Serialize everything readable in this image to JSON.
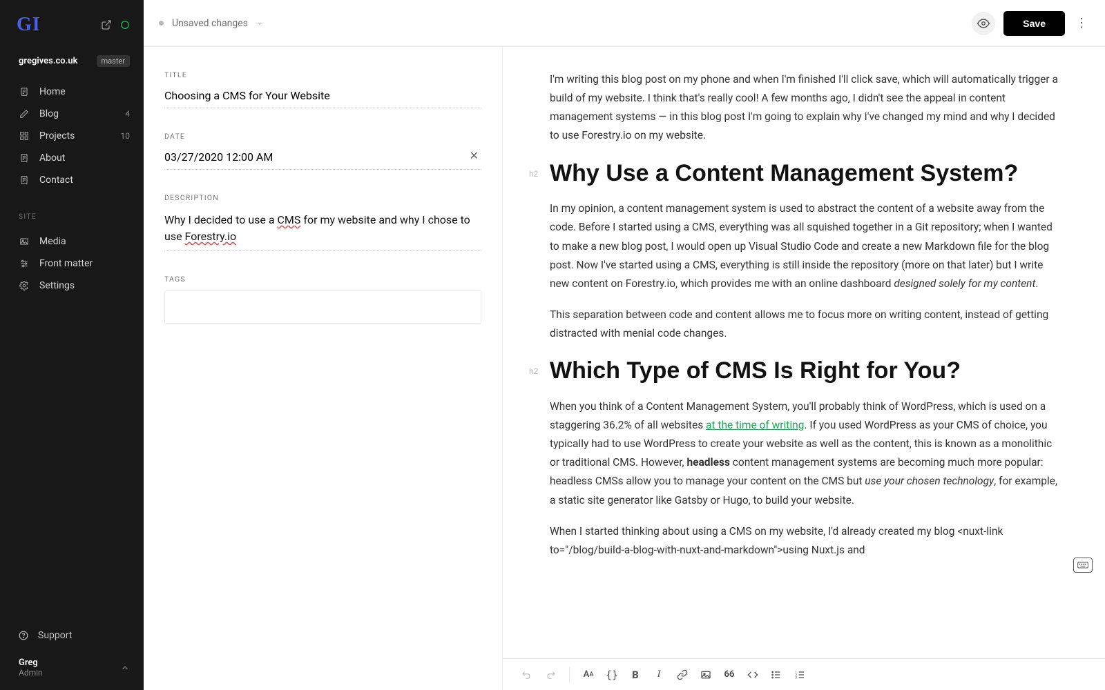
{
  "logo": "GI",
  "site_name": "gregives.co.uk",
  "branch": "master",
  "nav": {
    "items": [
      {
        "label": "Home"
      },
      {
        "label": "Blog",
        "count": "4"
      },
      {
        "label": "Projects",
        "count": "10"
      },
      {
        "label": "About"
      },
      {
        "label": "Contact"
      }
    ],
    "section_label": "SITE",
    "site_items": [
      {
        "label": "Media"
      },
      {
        "label": "Front matter"
      },
      {
        "label": "Settings"
      }
    ]
  },
  "footer": {
    "support": "Support",
    "username": "Greg",
    "role": "Admin"
  },
  "topbar": {
    "status": "Unsaved changes",
    "save": "Save"
  },
  "form": {
    "title_label": "TITLE",
    "title_value": "Choosing a CMS for Your Website",
    "date_label": "DATE",
    "date_value": "03/27/2020 12:00 AM",
    "desc_label": "DESCRIPTION",
    "desc_p1a": "Why I decided to use a ",
    "desc_sp1": "CMS",
    "desc_p1b": " for my website and why I chose to use ",
    "desc_sp2": "Forestry.io",
    "tags_label": "TAGS"
  },
  "article": {
    "intro": "I'm writing this blog post on my phone and when I'm finished I'll click save, which will automatically trigger a build of my website. I think that's really cool! A few months ago, I didn't see the appeal in content management systems — in this blog post I'm going to explain why I've changed my mind and why I decided to use Forestry.io on my website.",
    "h2_1_tag": "h2",
    "h2_1": "Why Use a Content Management System?",
    "p2a": "In my opinion, a content management system is used to abstract the content of a website away from the code. Before I started using a CMS, everything was all squished together in a Git repository; when I wanted to make a new blog post, I would open up Visual Studio Code and create a new Markdown file for the blog post. Now I've started using a CMS, everything is still inside the repository (more on that later) but I write new content on Forestry.io, which provides me with an online dashboard ",
    "p2em": "designed solely for my content",
    "p2b": ".",
    "p3": "This separation between code and content allows me to focus more on writing content, instead of getting distracted with menial code changes.",
    "h2_2_tag": "h2",
    "h2_2": "Which Type of CMS Is Right for You?",
    "p4a": "When you think of a Content Management System, you'll probably think of WordPress, which is used on a staggering 36.2% of all websites ",
    "p4link": "at the time of writing",
    "p4b": ". If you used WordPress as your CMS of choice, you typically had to use WordPress to create your website as well as the content, this is known as a monolithic or traditional CMS. However, ",
    "p4strong": "headless",
    "p4c": " content management systems are becoming much more popular: headless CMSs allow you to manage your content on the CMS but ",
    "p4em": "use your chosen technology",
    "p4d": ", for example, a static site generator like Gatsby or Hugo, to build your website.",
    "p5": "When I started thinking about using a CMS on my website, I'd already created my blog  <nuxt-link to=\"/blog/build-a-blog-with-nuxt-and-markdown\">using Nuxt.js and"
  },
  "toolbar": {
    "quote": "66"
  }
}
